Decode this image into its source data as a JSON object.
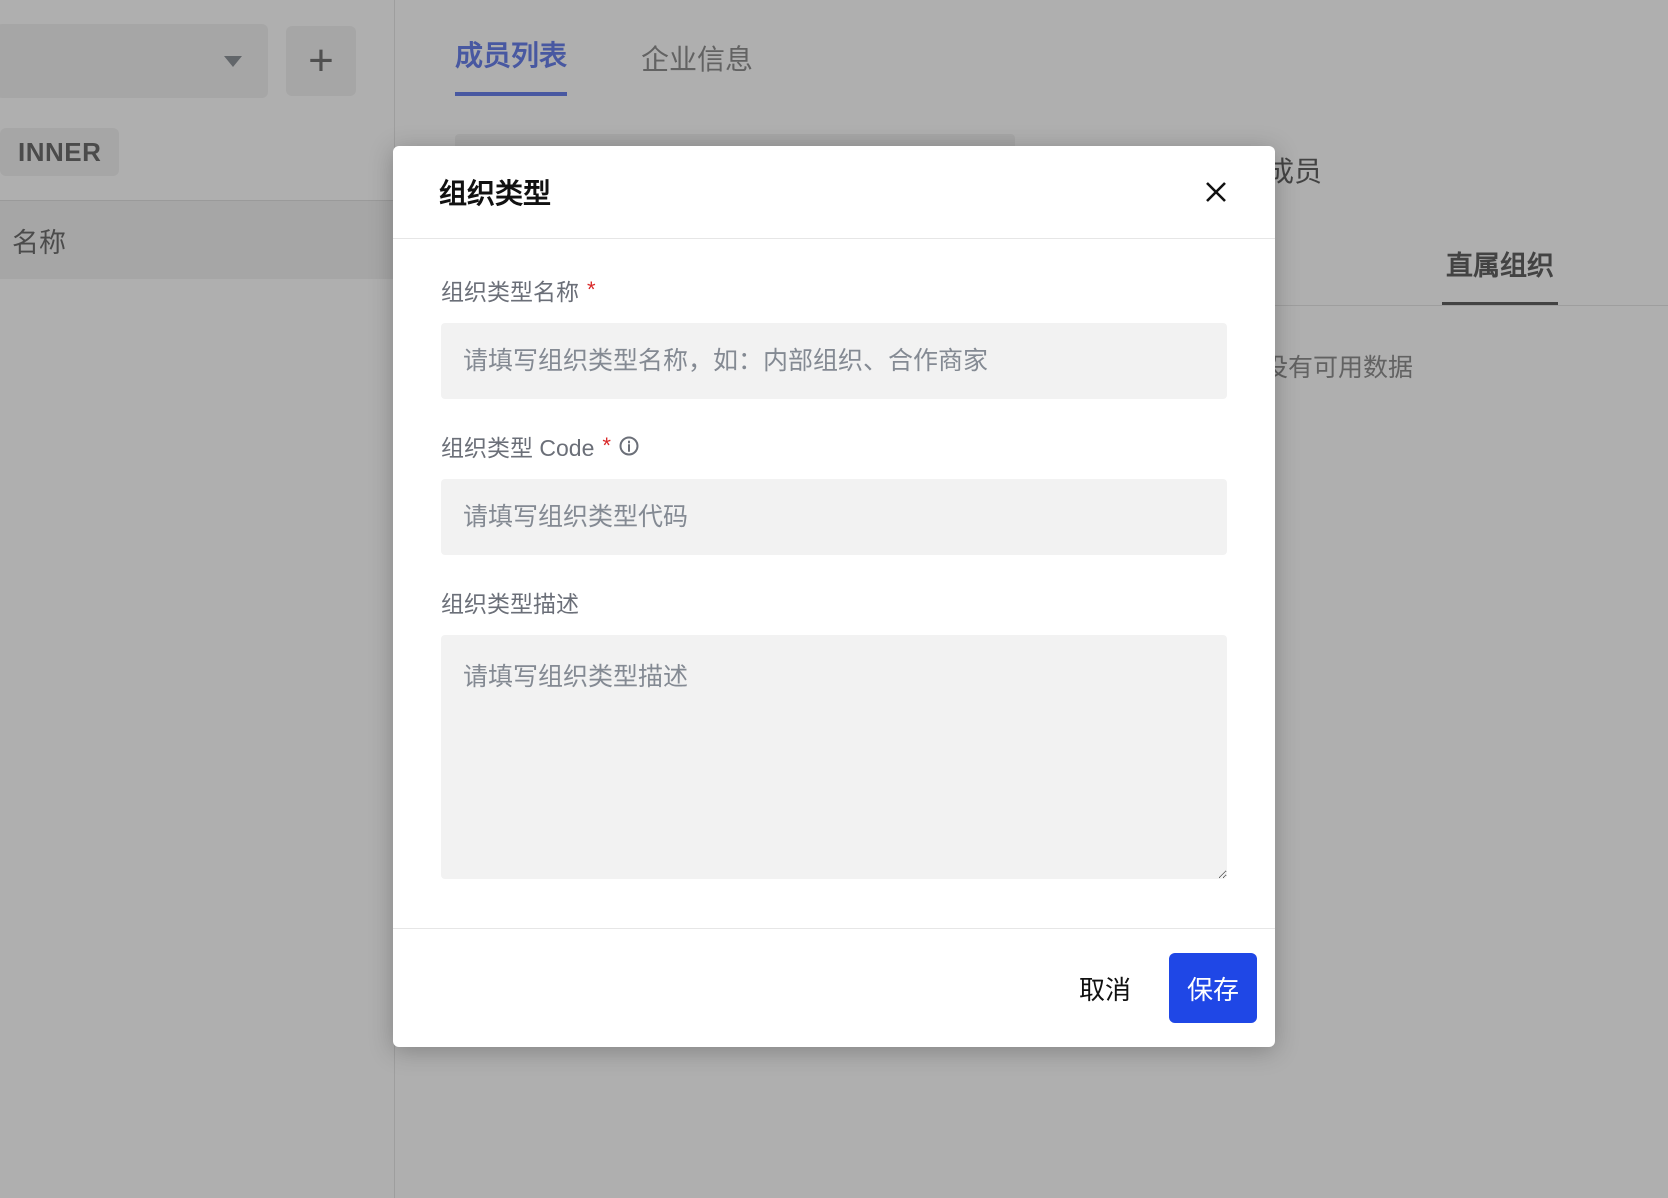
{
  "left": {
    "badge_text": "INNER",
    "list_item_label": "名称"
  },
  "add_button": {
    "label": "+"
  },
  "tabs": {
    "members": "成员列表",
    "enterprise": "企业信息"
  },
  "member_column": "属成员",
  "subtab": "直属组织",
  "empty": "没有可用数据",
  "modal": {
    "title": "组织类型",
    "name_label": "组织类型名称",
    "name_placeholder": "请填写组织类型名称，如：内部组织、合作商家",
    "code_label": "组织类型 Code",
    "code_placeholder": "请填写组织类型代码",
    "desc_label": "组织类型描述",
    "desc_placeholder": "请填写组织类型描述",
    "cancel": "取消",
    "save": "保存"
  }
}
